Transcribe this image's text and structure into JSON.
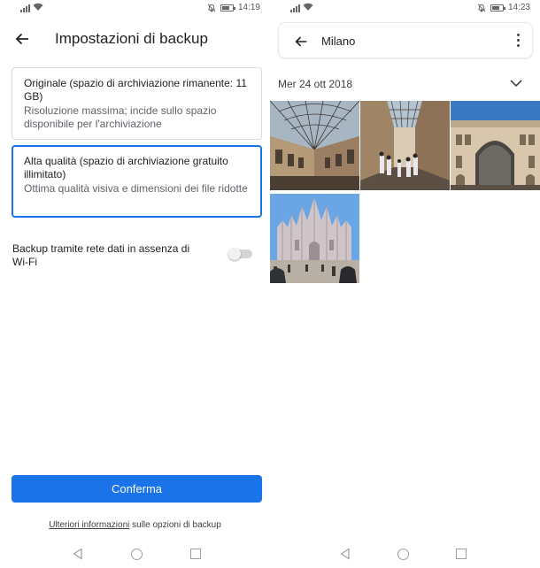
{
  "left": {
    "status": {
      "time": "14:19"
    },
    "header": {
      "title": "Impostazioni di backup"
    },
    "options": [
      {
        "title": "Originale (spazio di archiviazione rimanente: 11 GB)",
        "description": "Risoluzione massima; incide sullo spazio disponibile per l'archiviazione",
        "selected": false
      },
      {
        "title": "Alta qualità (spazio di archiviazione gratuito illimitato)",
        "description": "Ottima qualità visiva e dimensioni dei file ridotte",
        "selected": true
      }
    ],
    "cellular_backup": {
      "label": "Backup tramite rete dati in assenza di Wi-Fi",
      "enabled": false
    },
    "confirm_label": "Conferma",
    "footer": {
      "link": "Ulteriori informazioni",
      "text": " sulle opzioni di backup"
    }
  },
  "right": {
    "status": {
      "time": "14:23"
    },
    "search": {
      "value": "Milano"
    },
    "date_group": {
      "label": "Mer 24 ott 2018"
    },
    "photos": [
      {
        "subject": "galleria-glass-roof"
      },
      {
        "subject": "galleria-arcade-crowd"
      },
      {
        "subject": "galleria-entrance-arch"
      },
      {
        "subject": "duomo-di-milano"
      }
    ]
  },
  "icons": {
    "back": "arrow-left-icon",
    "more": "more-vert-icon",
    "expand": "chevron-down-icon",
    "nav": [
      "nav-back-icon",
      "nav-home-icon",
      "nav-recents-icon"
    ]
  },
  "colors": {
    "accent": "#1a73e8",
    "text_primary": "#202124",
    "text_secondary": "#5f6368",
    "border": "#dadce0"
  }
}
